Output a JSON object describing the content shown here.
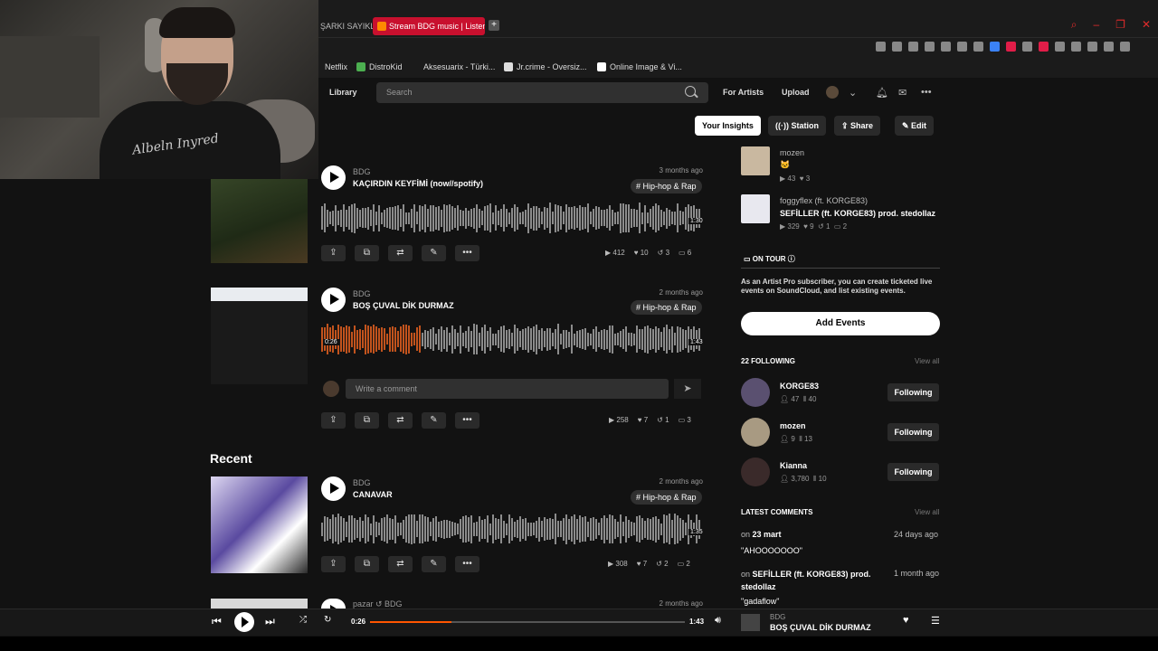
{
  "browser": {
    "tab_partial": "ŞARKI SAYIKLAR",
    "active_tab": "Stream BDG music | Listen",
    "bookmarks": [
      "Netflix",
      "DistroKid",
      "Aksesuarix - Türki...",
      "Jr.crime - Oversiz...",
      "Online Image & Vi..."
    ]
  },
  "header": {
    "library": "Library",
    "search_placeholder": "Search",
    "for_artists": "For Artists",
    "upload": "Upload"
  },
  "webcam": {
    "shirt_text": "Albeln Inyred"
  },
  "tracks": [
    {
      "artist": "BDG",
      "title": "KAÇIRDIN KEYFİMİ (now//spotify)",
      "date": "3 months ago",
      "tag": "# Hip-hop & Rap",
      "duration": "1:30",
      "played": 0,
      "stats": {
        "plays": "412",
        "likes": "10",
        "reposts": "3",
        "comments": "6"
      }
    },
    {
      "artist": "BDG",
      "title": "BOŞ ÇUVAL DİK DURMAZ",
      "date": "2 months ago",
      "tag": "# Hip-hop & Rap",
      "current": "0:26",
      "duration": "1:43",
      "played": 0.26,
      "stats": {
        "plays": "258",
        "likes": "7",
        "reposts": "1",
        "comments": "3"
      }
    },
    {
      "artist": "BDG",
      "title": "CANAVAR",
      "date": "2 months ago",
      "tag": "# Hip-hop & Rap",
      "duration": "1:35",
      "played": 0,
      "stats": {
        "plays": "308",
        "likes": "7",
        "reposts": "2",
        "comments": "2"
      }
    },
    {
      "artist": "pazar ↺ BDG",
      "date": "2 months ago"
    }
  ],
  "comment_placeholder": "Write a comment",
  "recent_heading": "Recent",
  "right": {
    "buttons": {
      "insights": "Your Insights",
      "station": "Station",
      "share": "Share",
      "edit": "Edit"
    },
    "liked": [
      {
        "name": "mozen",
        "title": "🐱",
        "plays": "43",
        "likes": "3"
      },
      {
        "name": "foggyflex (ft. KORGE83)",
        "title": "SEFİLLER (ft. KORGE83) prod. stedollaz",
        "plays": "329",
        "likes": "9",
        "reposts": "1",
        "comments": "2"
      }
    ],
    "on_tour": "ON TOUR",
    "tour_text": "As an Artist Pro subscriber, you can create ticketed live events on SoundCloud, and list existing events.",
    "add_events": "Add Events",
    "following_heading": "22 FOLLOWING",
    "view_all": "View all",
    "following": [
      {
        "name": "KORGE83",
        "followers": "47",
        "tracks": "40",
        "button": "Following"
      },
      {
        "name": "mozen",
        "followers": "9",
        "tracks": "13",
        "button": "Following"
      },
      {
        "name": "Kianna",
        "followers": "3,780",
        "tracks": "10",
        "button": "Following"
      }
    ],
    "latest_comments_heading": "LATEST COMMENTS",
    "comments": [
      {
        "on": "on",
        "track": "23 mart",
        "when": "24 days ago",
        "text": "\"AHOOOOOOO\""
      },
      {
        "on": "on",
        "track": "SEFİLLER (ft. KORGE83) prod. stedollaz",
        "when": "1 month ago",
        "text": "\"gadaflow\""
      }
    ]
  },
  "player": {
    "current": "0:26",
    "duration": "1:43",
    "progress": 0.26,
    "artist": "BDG",
    "title": "BOŞ ÇUVAL DİK DURMAZ"
  },
  "colors": {
    "accent": "#ff5500",
    "waveform_played": "#c2531d",
    "tab_red": "#c8102e"
  }
}
